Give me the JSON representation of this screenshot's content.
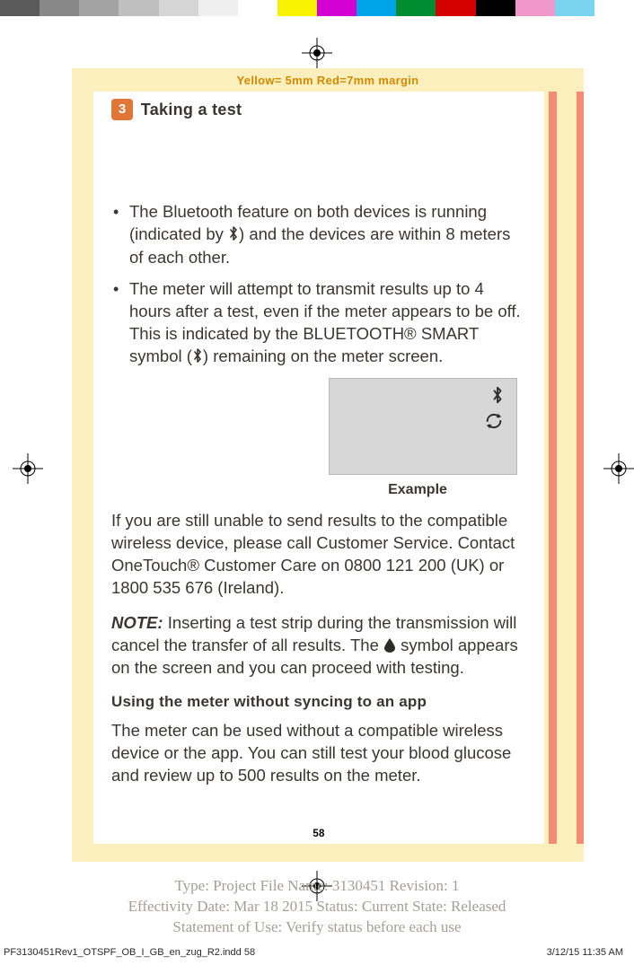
{
  "color_bar": [
    "#5a5a5a",
    "#888888",
    "#a3a3a3",
    "#bfbfbf",
    "#d6d6d6",
    "#efefef",
    "#ffffff",
    "#f6f200",
    "#d300d3",
    "#00a3e8",
    "#008c31",
    "#d30000",
    "#000000",
    "#f098cc",
    "#79d3f1",
    "#ffffff"
  ],
  "margin_label": "Yellow= 5mm  Red=7mm margin",
  "step": {
    "number": "3",
    "title": "Taking a test"
  },
  "bullets": [
    {
      "pre": "The Bluetooth feature on both devices is running (indicated by ",
      "post": ") and the devices are within 8 meters of each other."
    },
    {
      "pre": "The meter will attempt to transmit results up to 4 hours after a test, even if the meter appears to be off. This is indicated by the BLUETOOTH® SMART symbol (",
      "post": ") remaining on the meter screen."
    }
  ],
  "example_caption": "Example",
  "contact_para": "If you are still unable to send results to the compatible wireless device, please call Customer Service. Contact OneTouch® Customer Care on 0800 121 200 (UK) or 1800 535 676 (Ireland).",
  "note": {
    "label": "NOTE:",
    "pre": " Inserting a test strip during the transmission will cancel the transfer of all results. The ",
    "post": " symbol appears on the screen and you can proceed with testing."
  },
  "subhead": "Using the meter without syncing to an app",
  "sync_para": "The meter can be used without a compatible wireless device or the app. You can still test your blood glucose and review up to 500 results on the meter.",
  "page_number": "58",
  "metadata": {
    "line1": "Type: Project File  Name: 3130451  Revision: 1",
    "line2": "Effectivity Date: Mar 18 2015     Status: Current     State: Released",
    "line3": "Statement of Use: Verify status before each use"
  },
  "footer": {
    "left": "PF3130451Rev1_OTSPF_OB_I_GB_en_zug_R2.indd   58",
    "right": "3/12/15   11:35 AM"
  },
  "icons": {
    "bluetooth": "bluetooth-icon",
    "sync": "sync-icon",
    "drop": "blood-drop-icon",
    "registration": "registration-mark-icon"
  }
}
